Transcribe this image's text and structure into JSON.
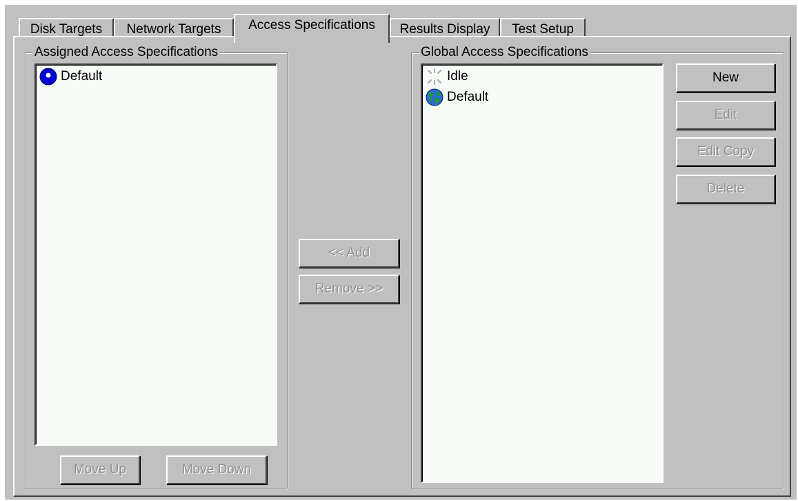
{
  "tabs": [
    "Disk Targets",
    "Network Targets",
    "Access Specifications",
    "Results Display",
    "Test Setup"
  ],
  "active_tab": "Access Specifications",
  "assigned": {
    "title": "Assigned Access Specifications",
    "items": [
      {
        "label": "Default",
        "icon": "blue-sphere-icon"
      }
    ],
    "move_up_label": "Move Up",
    "move_down_label": "Move Down"
  },
  "middle": {
    "add_label": "<< Add",
    "remove_label": "Remove >>"
  },
  "global": {
    "title": "Global Access Specifications",
    "items": [
      {
        "label": "Idle",
        "icon": "idle-sparkle-icon"
      },
      {
        "label": "Default",
        "icon": "globe-icon"
      }
    ],
    "new_label": "New",
    "edit_label": "Edit",
    "edit_copy_label": "Edit Copy",
    "delete_label": "Delete"
  }
}
